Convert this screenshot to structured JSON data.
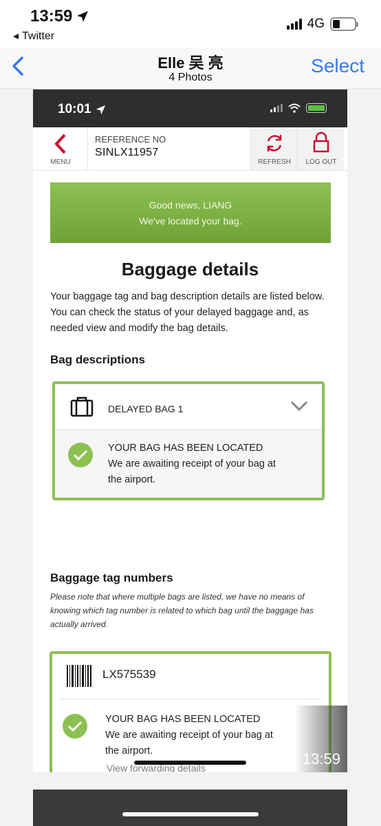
{
  "os_status": {
    "time": "13:59",
    "back_app": "Twitter",
    "network": "4G"
  },
  "nav": {
    "title": "Elle 吴 亮",
    "subtitle": "4 Photos",
    "select": "Select"
  },
  "inner": {
    "status_time": "10:01",
    "menu_label": "MENU",
    "reference_label": "REFERENCE NO",
    "reference_value": "SINLX11957",
    "refresh_label": "REFRESH",
    "logout_label": "LOG OUT",
    "banner_line1": "Good news, LIANG",
    "banner_line2": "We've located your bag.",
    "heading": "Baggage details",
    "intro": "Your baggage tag and bag description details are listed below. You can check the status of your delayed baggage and, as needed view and modify the bag details.",
    "bag_descriptions_heading": "Bag descriptions",
    "bag_label": "DELAYED BAG 1",
    "bag_status": "YOUR BAG HAS BEEN LOCATED",
    "bag_status_line2": "We are awaiting receipt of your bag at",
    "bag_status_line3": "the airport.",
    "tag_heading": "Baggage tag numbers",
    "tag_note": "Please note that where multiple bags are listed, we have no means of knowing which tag number is related to which bag until the baggage has actually arrived.",
    "tag_number": "LX575539",
    "tag_status": "YOUR BAG HAS BEEN LOCATED",
    "tag_status_line2": "We are awaiting receipt of your bag at",
    "tag_status_line3": "the airport.",
    "forwarding_link": "View forwarding details",
    "video_time": "13:59"
  },
  "colors": {
    "accent_green": "#8cc152",
    "brand_red": "#c8102e",
    "ios_blue": "#3478f6"
  },
  "icons": [
    "location-arrow-icon",
    "back-chevron-icon",
    "chevron-left-icon",
    "refresh-icon",
    "lock-icon",
    "suitcase-icon",
    "chevron-down-icon",
    "check-circle-icon",
    "barcode-icon",
    "wifi-icon",
    "battery-icon"
  ]
}
